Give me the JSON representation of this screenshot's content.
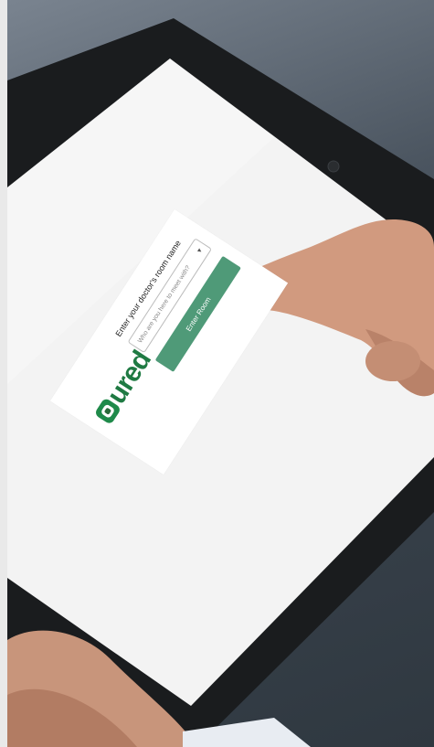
{
  "photo": {
    "description_icon": "tablet-photo"
  },
  "card": {
    "logo_text": "ured",
    "prompt": "Enter your doctor's room name",
    "select_placeholder": "Who are you here to meet with?",
    "select_chevron": "▾",
    "button_label": "Enter Room"
  },
  "colors": {
    "brand_green": "#1f7a43",
    "button_green": "#4f9a78",
    "tablet_bezel": "#1a1c1e",
    "screen": "#f3f3f3"
  }
}
